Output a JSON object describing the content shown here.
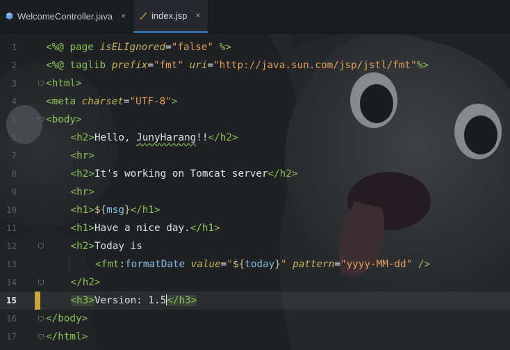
{
  "tabs": [
    {
      "label": "WelcomeController.java",
      "icon": "java-file-icon",
      "active": false
    },
    {
      "label": "index.jsp",
      "icon": "jsp-file-icon",
      "active": true
    }
  ],
  "close_glyph": "×",
  "lines": [
    {
      "num": "1",
      "parts": [
        [
          "t",
          "<%@ "
        ],
        [
          "t",
          "page "
        ],
        [
          "a",
          "isELIgnored"
        ],
        [
          "txt",
          "="
        ],
        [
          "s",
          "\"false\""
        ],
        [
          "t",
          " %>"
        ]
      ]
    },
    {
      "num": "2",
      "parts": [
        [
          "t",
          "<%@ "
        ],
        [
          "t",
          "taglib "
        ],
        [
          "a",
          "prefix"
        ],
        [
          "txt",
          "="
        ],
        [
          "s",
          "\"fmt\""
        ],
        [
          "txt",
          " "
        ],
        [
          "a",
          "uri"
        ],
        [
          "txt",
          "="
        ],
        [
          "s",
          "\"http://java.sun.com/jsp/jstl/fmt\""
        ],
        [
          "t",
          "%>"
        ]
      ]
    },
    {
      "num": "3",
      "parts": [
        [
          "t",
          "<html>"
        ]
      ]
    },
    {
      "num": "4",
      "parts": [
        [
          "t",
          "<meta "
        ],
        [
          "a",
          "charset"
        ],
        [
          "txt",
          "="
        ],
        [
          "s",
          "\"UTF-8\""
        ],
        [
          "t",
          ">"
        ]
      ]
    },
    {
      "num": "5",
      "parts": [
        [
          "t",
          "<body>"
        ]
      ]
    },
    {
      "num": "6",
      "indent": 1,
      "parts": [
        [
          "t",
          "<h2>"
        ],
        [
          "txt",
          "Hello, "
        ],
        [
          "uline",
          "JunyHarang"
        ],
        [
          "txt",
          "!!"
        ],
        [
          "t",
          "</h2>"
        ]
      ]
    },
    {
      "num": "7",
      "indent": 1,
      "parts": [
        [
          "t",
          "<hr>"
        ]
      ]
    },
    {
      "num": "8",
      "indent": 1,
      "parts": [
        [
          "t",
          "<h2>"
        ],
        [
          "txt",
          "It's working on Tomcat server"
        ],
        [
          "t",
          "</h2>"
        ]
      ]
    },
    {
      "num": "9",
      "indent": 1,
      "parts": [
        [
          "t",
          "<hr>"
        ]
      ]
    },
    {
      "num": "10",
      "indent": 1,
      "parts": [
        [
          "t",
          "<h1>"
        ],
        [
          "e",
          "${"
        ],
        [
          "ev",
          "msg"
        ],
        [
          "e",
          "}"
        ],
        [
          "t",
          "</h1>"
        ]
      ]
    },
    {
      "num": "11",
      "indent": 1,
      "parts": [
        [
          "t",
          "<h1>"
        ],
        [
          "txt",
          "Have a nice day."
        ],
        [
          "t",
          "</h1>"
        ]
      ]
    },
    {
      "num": "12",
      "indent": 1,
      "parts": [
        [
          "t",
          "<h2>"
        ],
        [
          "txt",
          "Today is"
        ]
      ]
    },
    {
      "num": "13",
      "indent": 2,
      "parts": [
        [
          "t",
          "<fmt"
        ],
        [
          "txt",
          ":"
        ],
        [
          "k",
          "formatDate "
        ],
        [
          "a",
          "value"
        ],
        [
          "txt",
          "="
        ],
        [
          "s",
          "\""
        ],
        [
          "e",
          "${"
        ],
        [
          "ev",
          "today"
        ],
        [
          "e",
          "}"
        ],
        [
          "s",
          "\""
        ],
        [
          "txt",
          " "
        ],
        [
          "a",
          "pattern"
        ],
        [
          "txt",
          "="
        ],
        [
          "s",
          "\"yyyy-MM-dd\""
        ],
        [
          "t",
          " />"
        ]
      ]
    },
    {
      "num": "14",
      "indent": 1,
      "parts": [
        [
          "t",
          "</h2>"
        ]
      ]
    },
    {
      "num": "15",
      "indent": 1,
      "current": true,
      "parts": [
        [
          "hlt",
          "<h3>"
        ],
        [
          "txt",
          "Version: 1.5"
        ],
        [
          "cursor",
          ""
        ],
        [
          "hlt",
          "</h3>"
        ]
      ]
    },
    {
      "num": "16",
      "parts": [
        [
          "t",
          "</body>"
        ]
      ]
    },
    {
      "num": "17",
      "parts": [
        [
          "t",
          "</html>"
        ]
      ]
    }
  ],
  "fold_lines": [
    "3",
    "5",
    "12",
    "14",
    "16",
    "17"
  ],
  "colors": {
    "tag": "#8cc45a",
    "attribute": "#c8b65e",
    "string": "#e3a15a",
    "marker": "#c9a53a",
    "accent": "#3d86e0"
  }
}
